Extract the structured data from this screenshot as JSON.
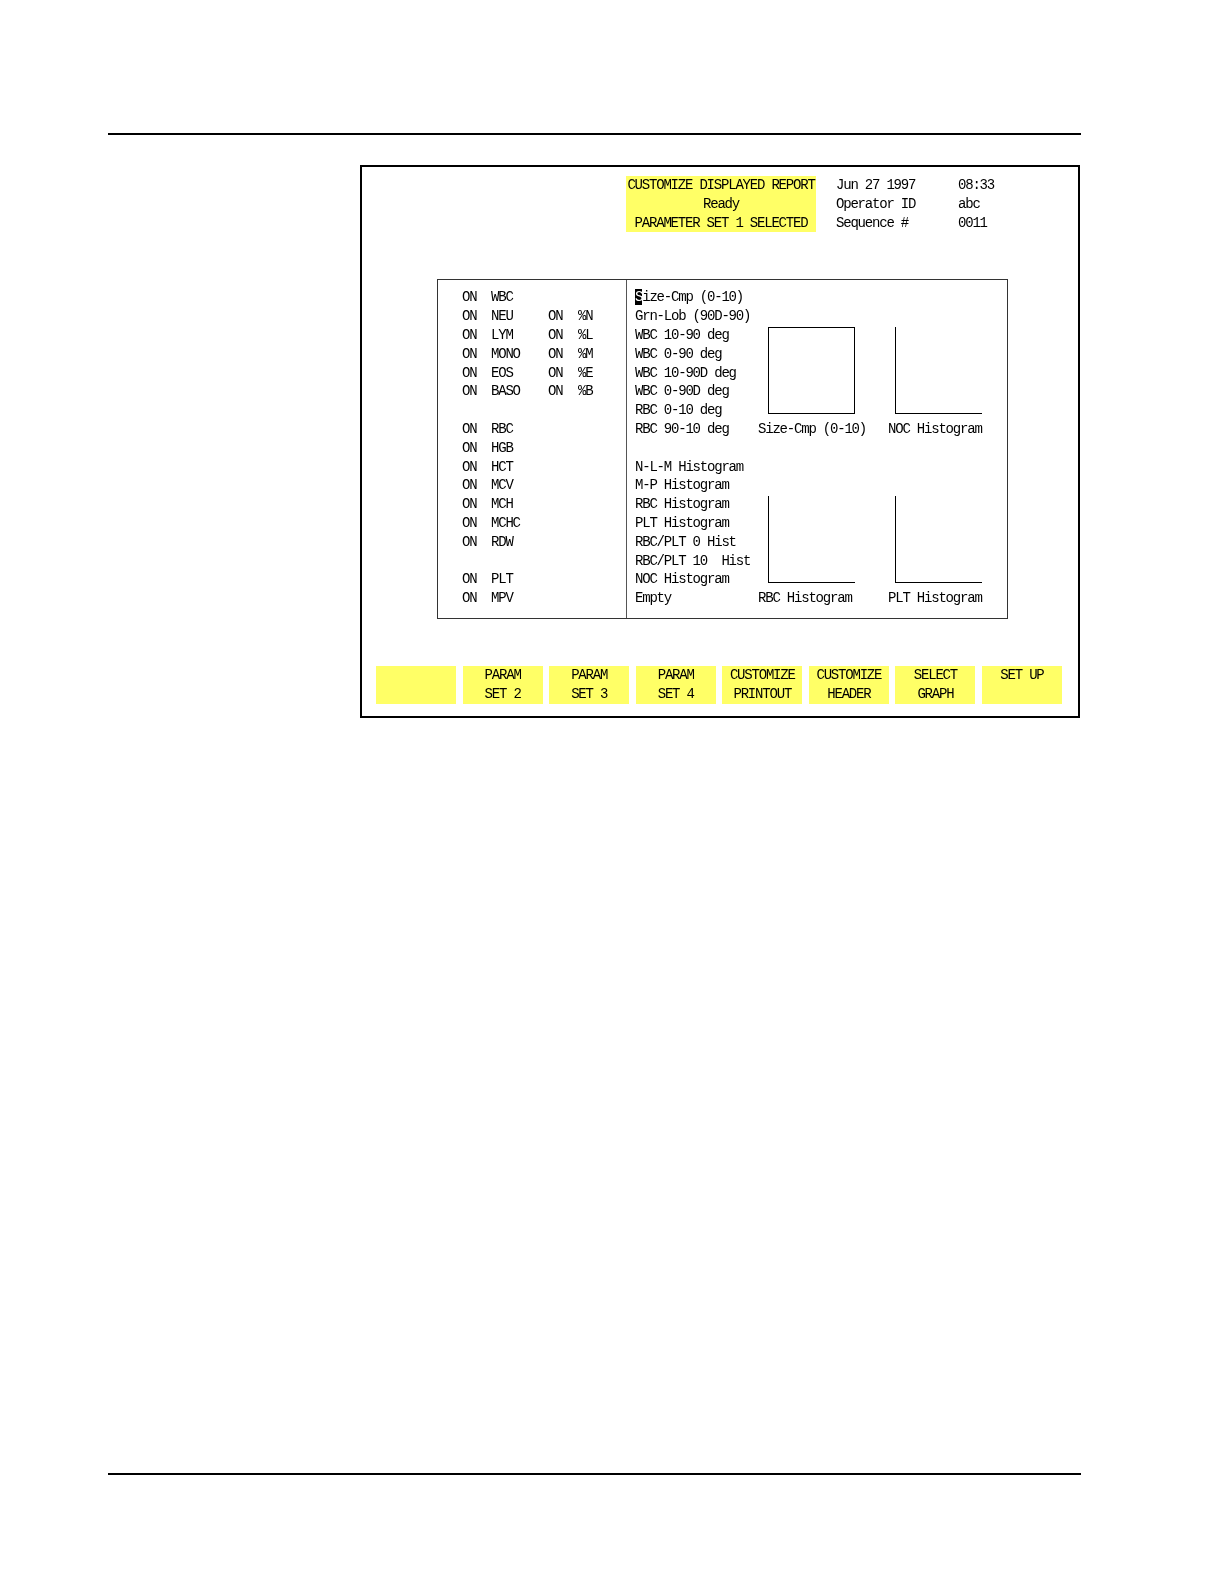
{
  "header": {
    "title": "CUSTOMIZE DISPLAYED REPORT",
    "status": "Ready",
    "parameter_set": "PARAMETER SET 1 SELECTED"
  },
  "info": {
    "date": "Jun 27 1997",
    "time": "08:33",
    "fields": [
      {
        "label": "Operator ID",
        "value": "abc"
      },
      {
        "label": "Sequence #",
        "value": "0011"
      }
    ]
  },
  "parameter_groups": [
    {
      "rows": [
        {
          "status": "ON",
          "name": "WBC"
        },
        {
          "status": "ON",
          "name": "NEU",
          "percent": {
            "status": "ON",
            "name": "%N"
          }
        },
        {
          "status": "ON",
          "name": "LYM",
          "percent": {
            "status": "ON",
            "name": "%L"
          }
        },
        {
          "status": "ON",
          "name": "MONO",
          "percent": {
            "status": "ON",
            "name": "%M"
          }
        },
        {
          "status": "ON",
          "name": "EOS",
          "percent": {
            "status": "ON",
            "name": "%E"
          }
        },
        {
          "status": "ON",
          "name": "BASO",
          "percent": {
            "status": "ON",
            "name": "%B"
          }
        }
      ]
    },
    {
      "rows": [
        {
          "status": "ON",
          "name": "RBC"
        },
        {
          "status": "ON",
          "name": "HGB"
        },
        {
          "status": "ON",
          "name": "HCT"
        },
        {
          "status": "ON",
          "name": "MCV"
        },
        {
          "status": "ON",
          "name": "MCH"
        },
        {
          "status": "ON",
          "name": "MCHC"
        },
        {
          "status": "ON",
          "name": "RDW"
        }
      ]
    },
    {
      "rows": [
        {
          "status": "ON",
          "name": "PLT"
        },
        {
          "status": "ON",
          "name": "MPV"
        }
      ]
    }
  ],
  "graph_options": [
    {
      "items": [
        {
          "label": "Size-Cmp (0-10)",
          "selected": true
        },
        {
          "label": "Grn-Lob (90D-90)",
          "selected": false
        },
        {
          "label": "WBC 10-90 deg",
          "selected": false
        },
        {
          "label": "WBC 0-90 deg",
          "selected": false
        },
        {
          "label": "WBC 10-90D deg",
          "selected": false
        },
        {
          "label": "WBC 0-90D deg",
          "selected": false
        },
        {
          "label": "RBC 0-10 deg",
          "selected": false
        },
        {
          "label": "RBC 90-10 deg",
          "selected": false
        }
      ]
    },
    {
      "items": [
        {
          "label": "N-L-M Histogram",
          "selected": false
        },
        {
          "label": "M-P Histogram",
          "selected": false
        },
        {
          "label": "RBC Histogram",
          "selected": false
        },
        {
          "label": "PLT Histogram",
          "selected": false
        },
        {
          "label": "RBC/PLT 0 Hist",
          "selected": false
        },
        {
          "label": "RBC/PLT 10  Hist",
          "selected": false
        },
        {
          "label": "NOC Histogram",
          "selected": false
        },
        {
          "label": "Empty",
          "selected": false
        }
      ]
    }
  ],
  "graphs": [
    {
      "kind": "scatter",
      "label": "Size-Cmp (0-10)"
    },
    {
      "kind": "histogram",
      "label": "NOC Histogram"
    },
    {
      "kind": "histogram",
      "label": "RBC Histogram"
    },
    {
      "kind": "histogram",
      "label": "PLT Histogram"
    }
  ],
  "soft_keys": [
    {
      "kind": "blank"
    },
    {
      "kind": "key",
      "lines": [
        "PARAM",
        "SET 2"
      ]
    },
    {
      "kind": "key",
      "lines": [
        "PARAM",
        "SET 3"
      ]
    },
    {
      "kind": "key",
      "lines": [
        "PARAM",
        "SET 4"
      ]
    },
    {
      "kind": "key",
      "lines": [
        "CUSTOMIZE",
        "PRINTOUT"
      ]
    },
    {
      "kind": "key",
      "lines": [
        "CUSTOMIZE",
        "HEADER"
      ]
    },
    {
      "kind": "key",
      "lines": [
        "SELECT",
        "GRAPH"
      ]
    },
    {
      "kind": "key",
      "lines": [
        "SET UP"
      ]
    }
  ]
}
